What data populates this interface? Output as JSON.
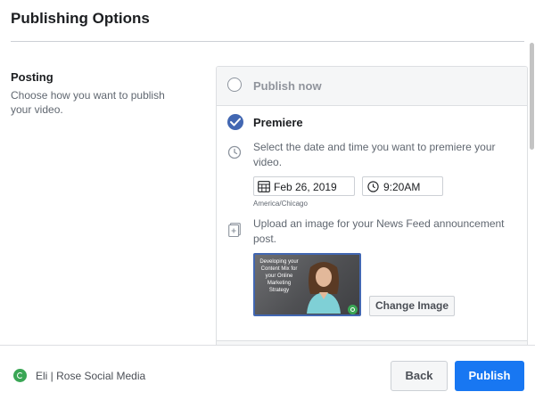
{
  "dialog": {
    "title": "Publishing Options"
  },
  "posting": {
    "label": "Posting",
    "description": "Choose how you want to publish your video."
  },
  "options": {
    "publish_now": {
      "label": "Publish now",
      "selected": false
    },
    "premiere": {
      "label": "Premiere",
      "selected": true,
      "date_description": "Select the date and time you want to premiere your video.",
      "date_value": "Feb 26, 2019",
      "time_value": "9:20AM",
      "timezone": "America/Chicago",
      "upload_description": "Upload an image for your News Feed announcement post.",
      "thumbnail_text": "Developing your Content Mix for your Online Marketing Strategy",
      "change_image_label": "Change Image"
    }
  },
  "footer": {
    "page_name": "Eli | Rose Social Media",
    "back_label": "Back",
    "publish_label": "Publish"
  },
  "colors": {
    "accent": "#4267b2",
    "publish_button": "#1877f2",
    "brand_green": "#3aa655"
  },
  "icons": [
    "check-icon",
    "clock-icon",
    "calendar-icon",
    "upload-image-icon",
    "page-logo-icon"
  ]
}
